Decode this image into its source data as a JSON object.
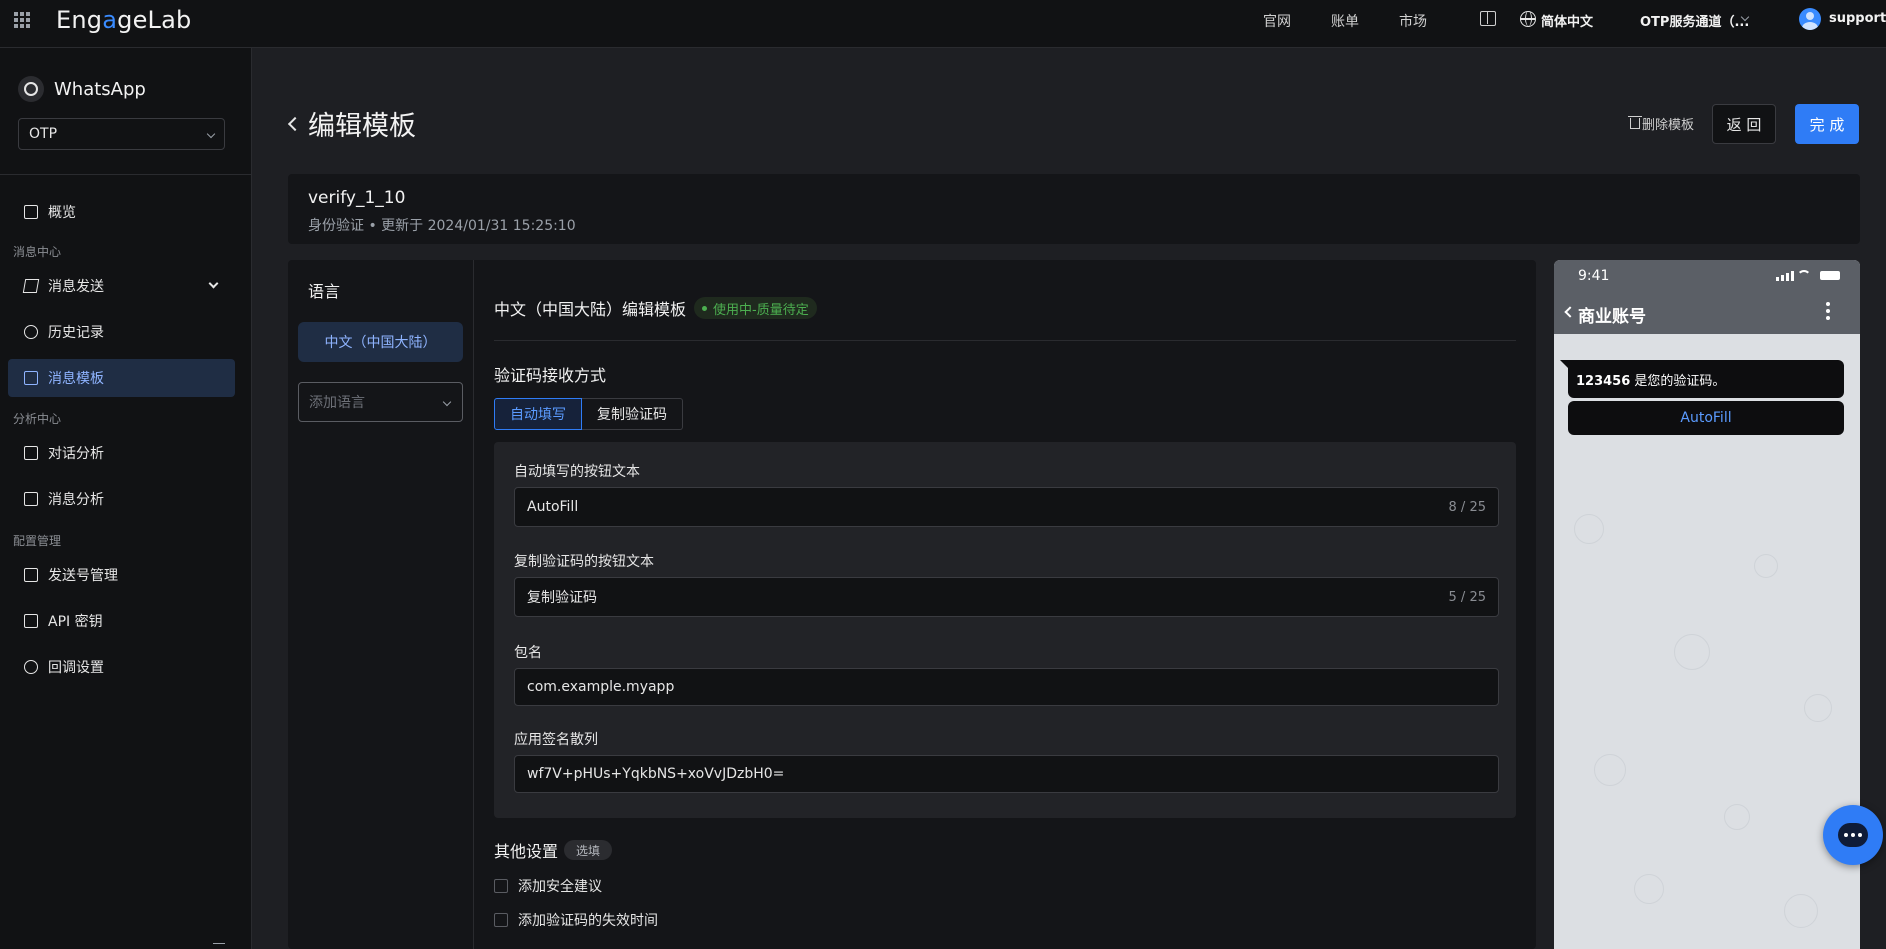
{
  "topbar": {
    "brand": "EngageLab",
    "links": [
      "官网",
      "账单",
      "市场"
    ],
    "language": "简体中文",
    "channel": "OTP服务通道（...",
    "user": "support"
  },
  "sidebar": {
    "app_title": "WhatsApp",
    "app_select": "OTP",
    "sections": {
      "messages": "消息中心",
      "analysis": "分析中心",
      "config": "配置管理"
    },
    "items": {
      "overview": "概览",
      "send": "消息发送",
      "history": "历史记录",
      "templates": "消息模板",
      "conversation": "对话分析",
      "msg_analysis": "消息分析",
      "numbers": "发送号管理",
      "api_key": "API 密钥",
      "callback": "回调设置"
    }
  },
  "header": {
    "title": "编辑模板",
    "delete": "删除模板",
    "back": "返 回",
    "done": "完 成"
  },
  "template": {
    "name": "verify_1_10",
    "meta": "身份验证 • 更新于 2024/01/31 15:25:10"
  },
  "language_panel": {
    "title": "语言",
    "active": "中文（中国大陆）",
    "add_placeholder": "添加语言"
  },
  "form": {
    "heading": "中文（中国大陆）编辑模板",
    "status": "使用中-质量待定",
    "receive_title": "验证码接收方式",
    "tabs": [
      "自动填写",
      "复制验证码"
    ],
    "autofill_label": "自动填写的按钮文本",
    "autofill_value": "AutoFill",
    "autofill_count": "8 / 25",
    "copy_label": "复制验证码的按钮文本",
    "copy_value": "复制验证码",
    "copy_count": "5 / 25",
    "package_label": "包名",
    "package_value": "com.example.myapp",
    "hash_label": "应用签名散列",
    "hash_value": "wf7V+pHUs+YqkbNS+xoVvJDzbH0=",
    "other_title": "其他设置",
    "optional": "选填",
    "check_security": "添加安全建议",
    "check_expiry": "添加验证码的失效时间"
  },
  "preview": {
    "time": "9:41",
    "account": "商业账号",
    "code": "123456",
    "message_suffix": " 是您的验证码。",
    "button": "AutoFill"
  },
  "colors": {
    "accent": "#2f7cf6",
    "status_green": "#4caf50",
    "bg_dark": "#111214",
    "bg_main": "#1e1f23"
  }
}
